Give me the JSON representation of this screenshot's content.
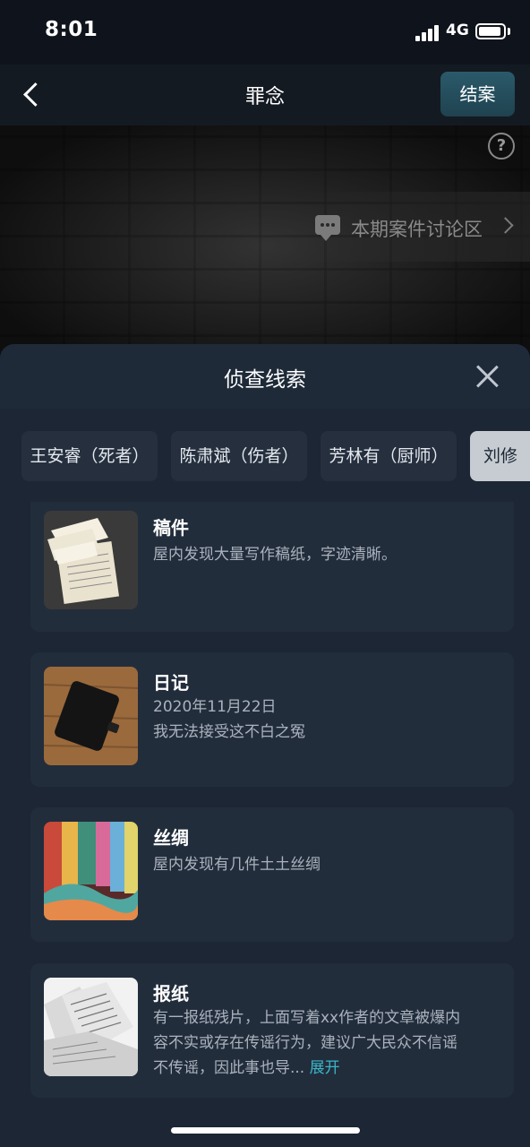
{
  "status": {
    "time": "8:01",
    "network": "4G"
  },
  "nav": {
    "title": "罪念",
    "close_case_label": "结案"
  },
  "scene": {
    "discussion_label": "本期案件讨论区",
    "help_glyph": "?"
  },
  "sheet": {
    "title": "侦查线索",
    "tabs": [
      {
        "label": "王安睿（死者）",
        "active": false
      },
      {
        "label": "陈肃斌（伤者）",
        "active": false
      },
      {
        "label": "芳林有（厨师）",
        "active": false
      },
      {
        "label": "刘修",
        "active": true
      }
    ],
    "clues": [
      {
        "title": "稿件",
        "lines": [
          "屋内发现大量写作稿纸，字迹清晰。"
        ],
        "icon": "manuscript-image"
      },
      {
        "title": "日记",
        "lines": [
          "2020年11月22日",
          "我无法接受这不白之冤"
        ],
        "icon": "diary-image"
      },
      {
        "title": "丝绸",
        "lines": [
          "屋内发现有几件土土丝绸"
        ],
        "icon": "silk-image"
      },
      {
        "title": "报纸",
        "lines": [
          "有一报纸残片，上面写着xx作者的文章被爆内",
          "容不实或存在传谣行为，建议广大民众不信谣",
          "不传谣，因此事也导..."
        ],
        "expand_label": "展开",
        "icon": "newspaper-image"
      }
    ]
  },
  "colors": {
    "sheet_bg": "#1c2634",
    "card_bg": "#222d3c",
    "active_tab": "#c6ccd2",
    "link": "#3ab6c9",
    "close_case_btn": "#2b5a6a"
  }
}
